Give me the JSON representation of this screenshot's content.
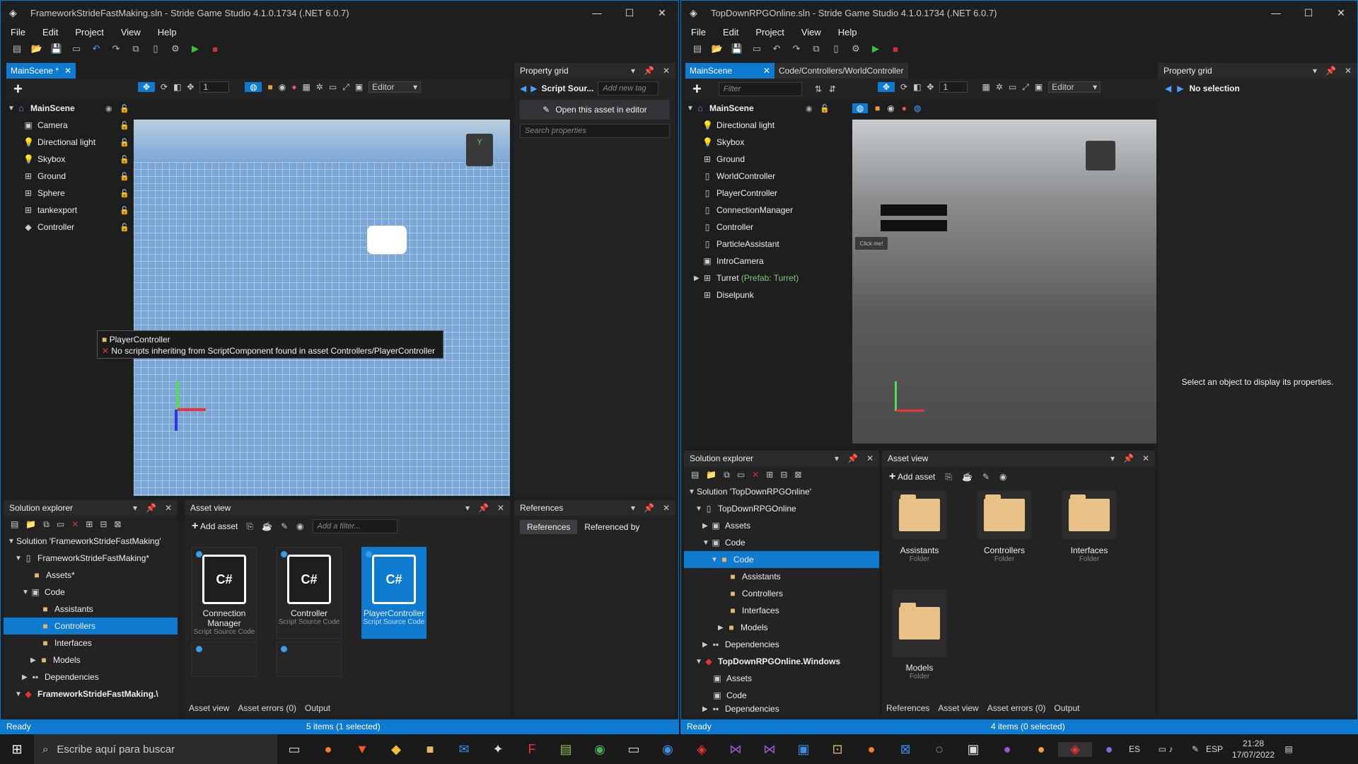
{
  "left": {
    "title": "FrameworkStrideFastMaking.sln - Stride Game Studio 4.1.0.1734 (.NET 6.0.7)",
    "menu": [
      "File",
      "Edit",
      "Project",
      "View",
      "Help"
    ],
    "scene_tab": "MainScene *",
    "zoom_value": "1",
    "editor_mode": "Editor",
    "scene_tree": {
      "root": "MainScene",
      "items": [
        "Camera",
        "Directional light",
        "Skybox",
        "Ground",
        "Sphere",
        "tankexport",
        "Controller"
      ]
    },
    "tooltip": {
      "title": "PlayerController",
      "message": "No scripts inheriting from ScriptComponent found in asset Controllers/PlayerController"
    },
    "property_grid": {
      "title": "Property grid",
      "asset_name": "Script Sour...",
      "tag_placeholder": "Add new tag",
      "open_button": "Open this asset in editor",
      "search_placeholder": "Search properties"
    },
    "references": {
      "title": "References",
      "tabs": [
        "References",
        "Referenced by"
      ]
    },
    "solution_explorer": {
      "title": "Solution explorer",
      "items": [
        "Solution 'FrameworkStrideFastMaking'",
        "FrameworkStrideFastMaking*",
        "Assets*",
        "Code",
        "Assistants",
        "Controllers",
        "Interfaces",
        "Models",
        "Dependencies",
        "FrameworkStrideFastMaking.\\"
      ]
    },
    "asset_view": {
      "title": "Asset view",
      "add_asset": "Add asset",
      "filter_placeholder": "Add a filter...",
      "cards": [
        {
          "name": "Connection Manager",
          "type": "Script Source Code"
        },
        {
          "name": "Controller",
          "type": "Script Source Code"
        },
        {
          "name": "PlayerController",
          "type": "Script Source Code"
        }
      ],
      "icon_text": "C#"
    },
    "bottom_tabs": [
      "Asset view",
      "Asset errors (0)",
      "Output"
    ],
    "status_ready": "Ready",
    "status_items": "5 items (1 selected)"
  },
  "right": {
    "title": "TopDownRPGOnline.sln - Stride Game Studio 4.1.0.1734 (.NET 6.0.7)",
    "menu": [
      "File",
      "Edit",
      "Project",
      "View",
      "Help"
    ],
    "tabs": [
      "MainScene",
      "Code/Controllers/WorldController"
    ],
    "filter_placeholder": "Filter",
    "zoom_value": "1",
    "editor_mode": "Editor",
    "scene_tree": {
      "root": "MainScene",
      "items": [
        "Directional light",
        "Skybox",
        "Ground",
        "WorldController",
        "PlayerController",
        "ConnectionManager",
        "Controller",
        "ParticleAssistant",
        "IntroCamera",
        "Turret",
        "Diselpunk"
      ],
      "prefab_suffix": "(Prefab: Turret)"
    },
    "viewport_buttons": {
      "click_me": "Click me!"
    },
    "property_grid": {
      "title": "Property grid",
      "header": "No selection",
      "message": "Select an object to display its properties."
    },
    "solution_explorer": {
      "title": "Solution explorer",
      "items": [
        "Solution 'TopDownRPGOnline'",
        "TopDownRPGOnline",
        "Assets",
        "Code",
        "Code",
        "Assistants",
        "Controllers",
        "Interfaces",
        "Models",
        "Dependencies",
        "TopDownRPGOnline.Windows",
        "Assets",
        "Code",
        "Dependencies"
      ]
    },
    "asset_view": {
      "title": "Asset view",
      "add_asset": "Add asset",
      "folders": [
        {
          "name": "Assistants",
          "type": "Folder"
        },
        {
          "name": "Controllers",
          "type": "Folder"
        },
        {
          "name": "Interfaces",
          "type": "Folder"
        },
        {
          "name": "Models",
          "type": "Folder"
        }
      ]
    },
    "bottom_tabs": [
      "References",
      "Asset view",
      "Asset errors (0)",
      "Output"
    ],
    "status_ready": "Ready",
    "status_items": "4 items (0 selected)"
  },
  "taskbar": {
    "search_placeholder": "Escribe aquí para buscar",
    "lang": "ES",
    "kbd": "ESP",
    "time": "21:28",
    "date": "17/07/2022"
  }
}
